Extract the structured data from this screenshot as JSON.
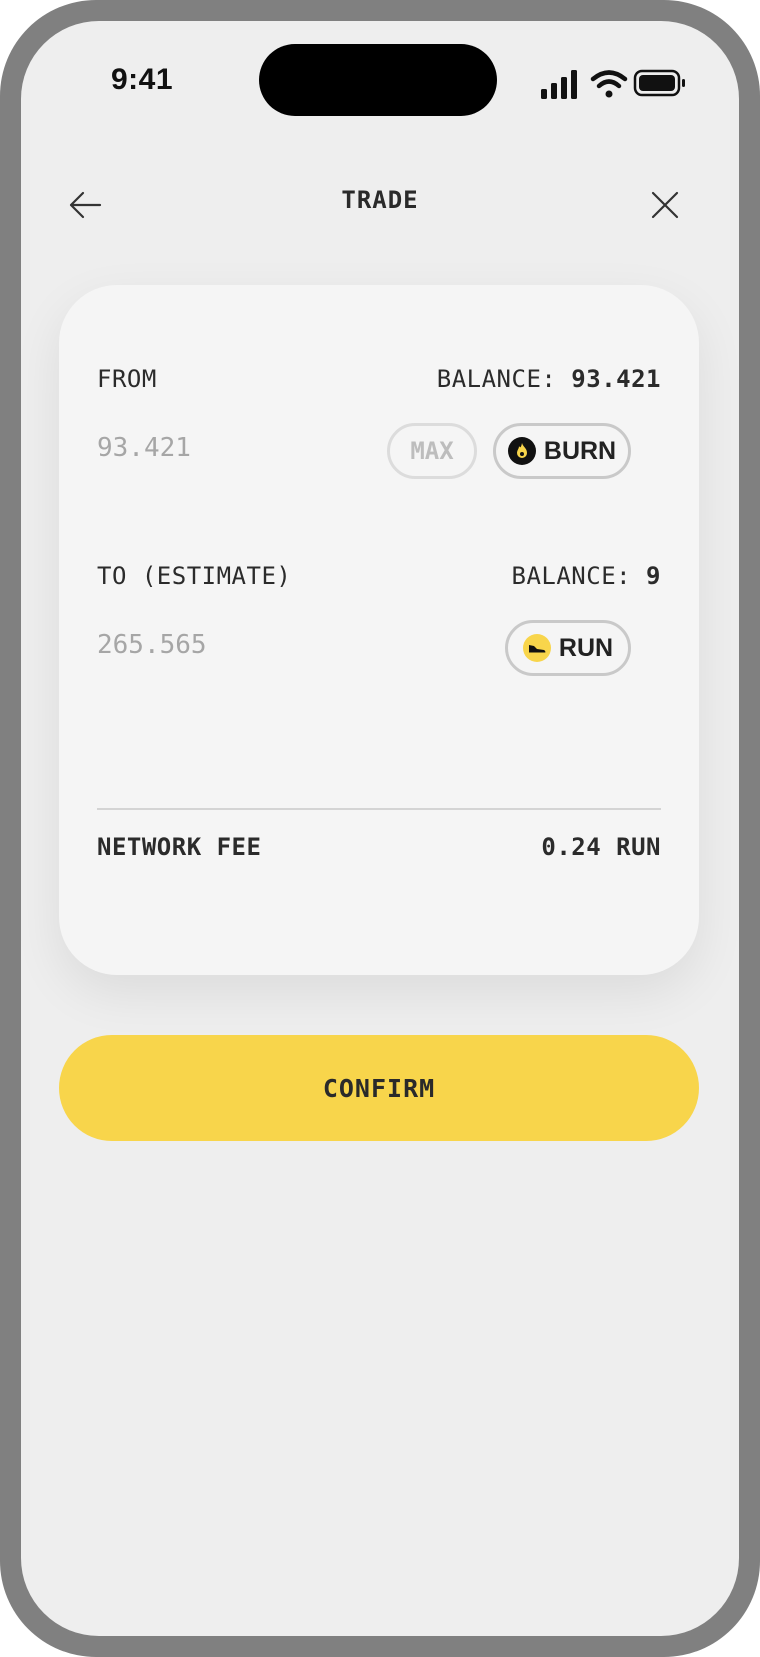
{
  "status_bar": {
    "time": "9:41"
  },
  "header": {
    "title": "TRADE",
    "back_icon": "arrow-left-icon",
    "close_icon": "close-icon"
  },
  "from": {
    "label": "FROM",
    "balance_label": "BALANCE:",
    "balance_value": "93.421",
    "amount": "93.421",
    "max_label": "MAX",
    "token": {
      "label": "BURN",
      "icon": "flame-icon"
    }
  },
  "to": {
    "label": "TO (ESTIMATE)",
    "balance_label": "BALANCE:",
    "balance_value": "9",
    "amount": "265.565",
    "token": {
      "label": "RUN",
      "icon": "sneaker-icon"
    }
  },
  "fee": {
    "label": "NETWORK FEE",
    "value": "0.24 RUN"
  },
  "confirm_label": "CONFIRM",
  "colors": {
    "accent": "#f8d54b",
    "background": "#eeeeee",
    "card": "#f5f5f5",
    "frame": "#808080"
  }
}
